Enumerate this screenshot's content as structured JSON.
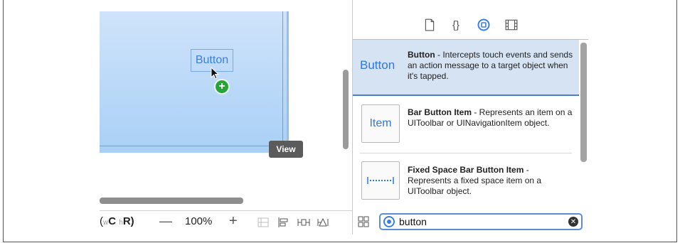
{
  "canvas": {
    "button_label": "Button",
    "tooltip": "View"
  },
  "bottom_bar": {
    "size_class": "(wC hR)",
    "size_class_w": "w",
    "size_class_c": "C",
    "size_class_h": "h",
    "size_class_r": "R)",
    "zoom_out": "—",
    "zoom_level": "100%",
    "zoom_in": "+",
    "icons": [
      "embed-in-stack-icon",
      "align-icon",
      "pin-icon",
      "resolve-issues-icon"
    ]
  },
  "library": {
    "tabs": [
      "file-template-icon",
      "code-snippet-icon",
      "object-library-icon",
      "media-library-icon"
    ],
    "active_tab": 2,
    "items": [
      {
        "thumb": "Button",
        "title": "Button",
        "desc": " - Intercepts touch events and sends an action message to a target object when it's tapped."
      },
      {
        "thumb": "Item",
        "title": "Bar Button Item",
        "desc": " - Represents an item on a UIToolbar or UINavigationItem object."
      },
      {
        "thumb": "",
        "title": "Fixed Space Bar Button Item",
        "desc": " - Represents a fixed space item on a UIToolbar object."
      }
    ]
  },
  "filter": {
    "value": "button"
  },
  "colors": {
    "accent": "#3b7fe0",
    "selection": "#d5e3f3",
    "badge_green": "#27a33a"
  }
}
